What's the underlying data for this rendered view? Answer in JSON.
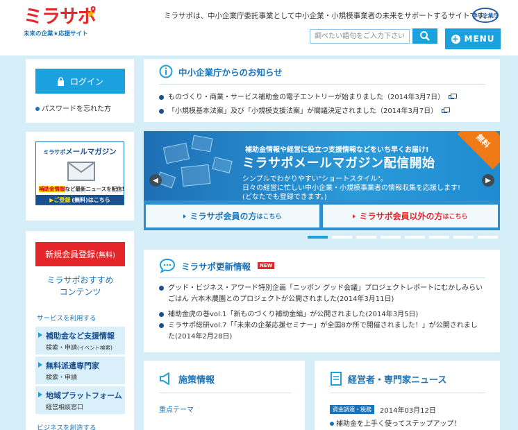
{
  "header": {
    "logo_text": "ミラサポ",
    "logo_sub": "未来の企業★応援サイト",
    "tagline": "ミラサポは、中小企業庁委託事業として中小企業・小規模事業者の未来をサポートするサイトです。",
    "ministry_badge": "中小企業庁",
    "search_placeholder": "調べたい語句をご入力下さい",
    "menu_label": "MENU"
  },
  "sidebar": {
    "login_label": "ログイン",
    "forgot_password": "パスワードを忘れた方",
    "mailmag": {
      "brand": "ミラサポ",
      "title": "メールマガジン",
      "note_highlight": "補助金情報",
      "note_rest": "など最新ニュースを配信!",
      "register_prefix": "▶ご登録",
      "register_free": "(無料)",
      "register_suffix": "はこちら"
    },
    "register_label": "新規会員登録",
    "register_free": "(無料)",
    "recommend_line1": "ミラサポおすすめ",
    "recommend_line2": "コンテンツ",
    "services_heading": "サービスを利用する",
    "services": [
      {
        "title": "補助金など支援情報",
        "sub": "検索・申請",
        "sub_small": "(イベント検索)"
      },
      {
        "title": "無料派遣専門家",
        "sub": "検索・申請",
        "sub_small": ""
      },
      {
        "title": "地域プラットフォーム",
        "sub": "経営相談窓口",
        "sub_small": ""
      }
    ],
    "create_heading": "ビジネスを創造する"
  },
  "notice": {
    "heading": "中小企業庁からのお知らせ",
    "items": [
      "ものづくり・商業・サービス補助金の電子エントリーが始まりました（2014年3月7日）",
      "「小規模基本法案」及び「小規模支援法案」が閣議決定されました（2014年3月7日）"
    ]
  },
  "carousel": {
    "sub": "補助金情報や経営に役立つ支援情報などをいち早くお届け!",
    "title": "ミラサポメールマガジン配信開始",
    "desc1": "シンプルでわかりやすい\"ショートスタイル\"。",
    "desc2": "日々の経営に忙しい中小企業・小規模事業者の情報収集を応援します!",
    "desc3": "(どなたでも登録できます。)",
    "free_badge": "無料",
    "member_btn": "ミラサポ会員の方",
    "member_btn_suffix": "はこちら",
    "nonmember_btn": "ミラサポ会員以外の方",
    "nonmember_btn_suffix": "はこちら",
    "slide_count": 8,
    "active_slide": 1
  },
  "updates": {
    "heading": "ミラサポ更新情報",
    "new_badge": "NEW",
    "items": [
      {
        "line1": "グッド・ビジネス・アワード特別企画「ニッポン グッド会議」プロジェクトレポートにむかしみらい",
        "line2": "ごはん 六本木農園とのプロジェクトが公開されました(2014年3月11日)"
      },
      {
        "line1": "補助金虎の巻vol.1「新ものづくり補助金編」が公開されました(2014年3月5日)",
        "line2": ""
      },
      {
        "line1": "ミラサポ総研vol.7「「未来の企業応援セミナー」が全国8か所で開催されました！」が公開されまし",
        "line2": "た(2014年2月28日)"
      }
    ]
  },
  "policy": {
    "heading": "施策情報",
    "focus_theme": "重点テーマ"
  },
  "expert": {
    "heading": "経営者・専門家ニュース",
    "tag": "資金調達・税務",
    "date": "2014年03月12日",
    "item": "補助金を上手く使ってステップアップ！"
  },
  "colors": {
    "accent_blue": "#1ba1dd",
    "brand_red": "#e4262b",
    "page_bg": "#d5eef8"
  }
}
